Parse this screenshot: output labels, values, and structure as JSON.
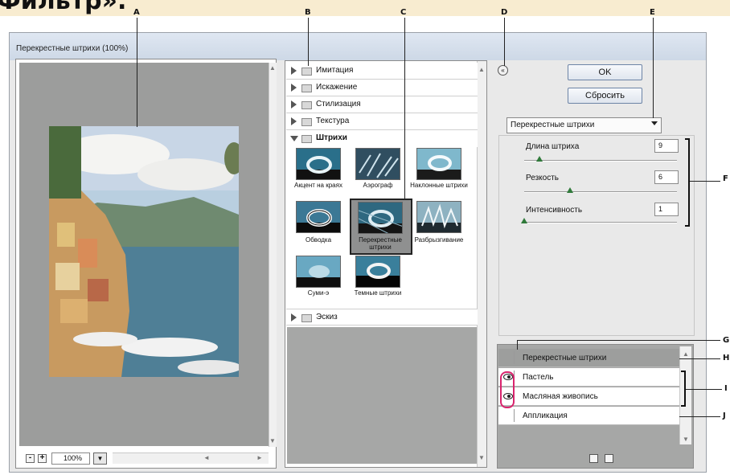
{
  "heading": {
    "text": "Фильтр»."
  },
  "callouts": {
    "a": "A",
    "b": "B",
    "c": "C",
    "d": "D",
    "e": "E",
    "f": "F",
    "g": "G",
    "h": "H",
    "i": "I",
    "j": "J"
  },
  "window": {
    "title": "Перекрестные штрихи (100%)"
  },
  "preview": {
    "zoom_value": "100%",
    "zoom_out": "-",
    "zoom_in": "+"
  },
  "filter_groups": [
    {
      "label": "Имитация",
      "expanded": false
    },
    {
      "label": "Искажение",
      "expanded": false
    },
    {
      "label": "Стилизация",
      "expanded": false
    },
    {
      "label": "Текстура",
      "expanded": false
    },
    {
      "label": "Штрихи",
      "expanded": true
    },
    {
      "label": "Эскиз",
      "expanded": false
    }
  ],
  "brush_filters": [
    {
      "label": "Акцент на краях",
      "icon": "accented-edges-thumbnail"
    },
    {
      "label": "Аэрограф",
      "icon": "spatter-thumbnail"
    },
    {
      "label": "Наклонные штрихи",
      "icon": "angled-strokes-thumbnail"
    },
    {
      "label": "Обводка",
      "icon": "ink-outlines-thumbnail"
    },
    {
      "label": "Перекрестные штрихи",
      "icon": "crosshatch-thumbnail",
      "selected": true
    },
    {
      "label": "Разбрызгивание",
      "icon": "sprayed-strokes-thumbnail"
    },
    {
      "label": "Суми-э",
      "icon": "sumi-e-thumbnail"
    },
    {
      "label": "Темные штрихи",
      "icon": "dark-strokes-thumbnail"
    }
  ],
  "buttons": {
    "ok": "OK",
    "reset": "Сбросить",
    "collapse": "«"
  },
  "filter_select": {
    "value": "Перекрестные штрихи"
  },
  "params": [
    {
      "label": "Длина штриха",
      "value": "9",
      "level": 0.1
    },
    {
      "label": "Резкость",
      "value": "6",
      "level": 0.3
    },
    {
      "label": "Интенсивность",
      "value": "1",
      "level": 0.0
    }
  ],
  "layers": [
    {
      "label": "Перекрестные штрихи",
      "visible": false,
      "active": true
    },
    {
      "label": "Пастель",
      "visible": true,
      "active": false
    },
    {
      "label": "Масляная живопись",
      "visible": true,
      "active": false
    },
    {
      "label": "Аппликация",
      "visible": false,
      "active": false
    }
  ],
  "colors": {
    "accent": "#d9246e",
    "slider_thumb": "#2f7a3a",
    "preview_bg": "#9c9d9c",
    "selected_layer": "#9d9e9d"
  }
}
